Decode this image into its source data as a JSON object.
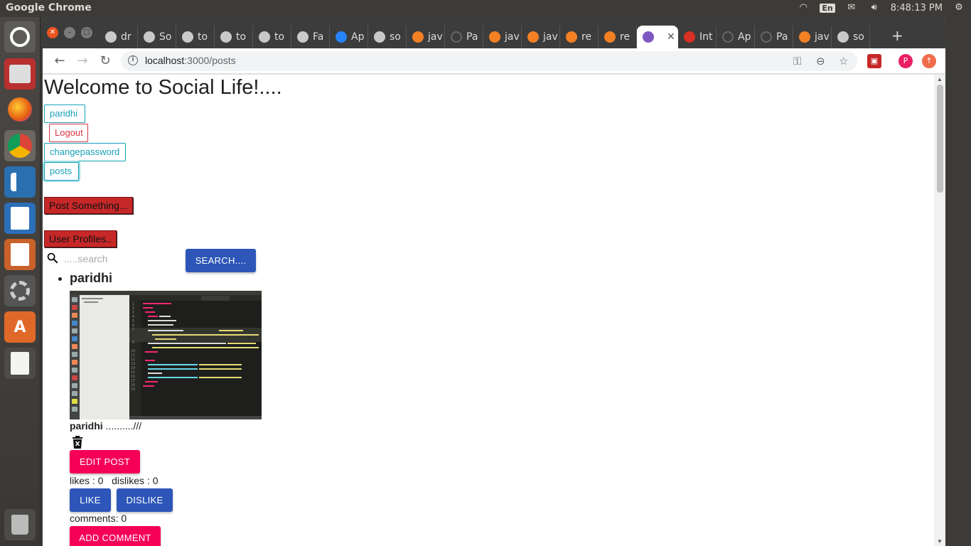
{
  "os": {
    "app_title": "Google Chrome",
    "keyboard_layout": "En",
    "clock": "8:48:13 PM"
  },
  "browser": {
    "tabs": [
      {
        "label": "dr",
        "icon": "github-icon"
      },
      {
        "label": "So",
        "icon": "github-icon"
      },
      {
        "label": "to",
        "icon": "github-icon"
      },
      {
        "label": "to",
        "icon": "github-icon"
      },
      {
        "label": "to",
        "icon": "github-icon"
      },
      {
        "label": "Fa",
        "icon": "github-icon"
      },
      {
        "label": "Ap",
        "icon": "bitbucket-icon"
      },
      {
        "label": "so",
        "icon": "github-icon"
      },
      {
        "label": "jav",
        "icon": "stackoverflow-icon"
      },
      {
        "label": "Pa",
        "icon": "loading-icon"
      },
      {
        "label": "jav",
        "icon": "stackoverflow-icon"
      },
      {
        "label": "jav",
        "icon": "stackoverflow-icon"
      },
      {
        "label": "re",
        "icon": "stackoverflow-icon"
      },
      {
        "label": "re",
        "icon": "stackoverflow-icon"
      },
      {
        "label": "",
        "icon": "app-icon",
        "active": true
      },
      {
        "label": "Int",
        "icon": "gmail-icon"
      },
      {
        "label": "Ap",
        "icon": "loading-icon"
      },
      {
        "label": "Pa",
        "icon": "loading-icon"
      },
      {
        "label": "jav",
        "icon": "stackoverflow-icon"
      },
      {
        "label": "so",
        "icon": "github-icon"
      }
    ],
    "new_tab": "+",
    "url_host": "localhost",
    "url_path": ":3000/posts",
    "profile_initial": "P"
  },
  "page": {
    "heading": "Welcome to Social Life!....",
    "nav": {
      "user": "paridhi",
      "logout": "Logout",
      "changepassword": "changepassword",
      "posts": "posts"
    },
    "post_something": "Post Something...",
    "user_profiles": "User Profiles..",
    "search": {
      "placeholder": ".....search",
      "button": "SEARCH...."
    },
    "post": {
      "author": "paridhi",
      "caption_author": "paridhi",
      "caption_text": " ..........///",
      "edit_button": "EDIT POST",
      "likes_text": "likes : 0   dislikes : 0",
      "like_button": "LIKE",
      "dislike_button": "DISLIKE",
      "comments_text": "comments: 0",
      "add_comment_button": "ADD COMMENT"
    }
  },
  "colors": {
    "accent_info": "#17a2b8",
    "accent_danger": "#dc3545",
    "red_button": "#c62828",
    "blue_button": "#2d56b8",
    "pink_button": "#f50057"
  }
}
